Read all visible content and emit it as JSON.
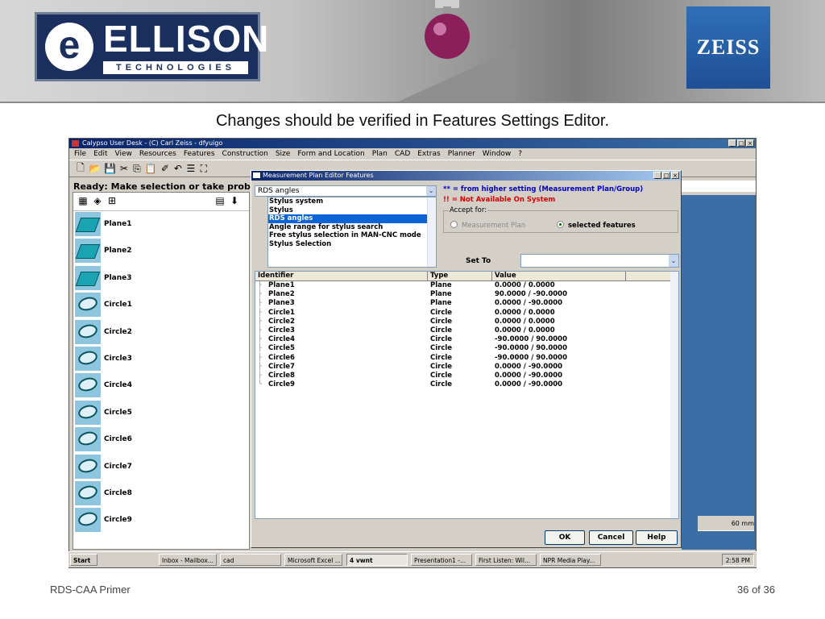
{
  "slide": {
    "caption": "Changes should be verified in Features Settings Editor.",
    "footer_left": "RDS-CAA Primer",
    "footer_right": "36 of 36",
    "logo_left": {
      "main": "ELLISON",
      "sub": "TECHNOLOGIES",
      "mark": "e"
    },
    "logo_right": "ZEISS"
  },
  "app": {
    "title": "Calypso User Desk - (C) Carl Zeiss - dfyuigo",
    "window_buttons": [
      "_",
      "□",
      "×"
    ],
    "menu": [
      "File",
      "Edit",
      "View",
      "Resources",
      "Features",
      "Construction",
      "Size",
      "Form and Location",
      "Plan",
      "CAD",
      "Extras",
      "Planner",
      "Window",
      "?"
    ],
    "status": "Ready: Make selection or take probings",
    "scale_label": "60 mm",
    "features": [
      {
        "name": "Plane1",
        "kind": "plane"
      },
      {
        "name": "Plane2",
        "kind": "plane"
      },
      {
        "name": "Plane3",
        "kind": "plane"
      },
      {
        "name": "Circle1",
        "kind": "circle"
      },
      {
        "name": "Circle2",
        "kind": "circle"
      },
      {
        "name": "Circle3",
        "kind": "circle"
      },
      {
        "name": "Circle4",
        "kind": "circle"
      },
      {
        "name": "Circle5",
        "kind": "circle"
      },
      {
        "name": "Circle6",
        "kind": "circle"
      },
      {
        "name": "Circle7",
        "kind": "circle"
      },
      {
        "name": "Circle8",
        "kind": "circle"
      },
      {
        "name": "Circle9",
        "kind": "circle"
      }
    ]
  },
  "dialog": {
    "title": "Measurement Plan Editor Features",
    "combo_value": "RDS angles",
    "list_items": [
      "Stylus system",
      "Stylus",
      "RDS angles",
      "Angle range for stylus search",
      "Free stylus selection in MAN-CNC mode",
      "Stylus Selection"
    ],
    "selected_index": 2,
    "legend_higher": "** = from higher setting (Measurement Plan/Group)",
    "legend_na": "!! = Not Available On System",
    "accept_title": "Accept for:",
    "accept_options": [
      "Measurement Plan",
      "selected features"
    ],
    "accept_selected": 1,
    "set_to_label": "Set To",
    "set_to_value": "",
    "columns": [
      "Identifier",
      "Type",
      "Value"
    ],
    "rows": [
      {
        "id": "Plane1",
        "type": "Plane",
        "value": "0.0000 / 0.0000"
      },
      {
        "id": "Plane2",
        "type": "Plane",
        "value": "90.0000 / -90.0000"
      },
      {
        "id": "Plane3",
        "type": "Plane",
        "value": "0.0000 / -90.0000"
      },
      {
        "id": "Circle1",
        "type": "Circle",
        "value": "0.0000 / 0.0000"
      },
      {
        "id": "Circle2",
        "type": "Circle",
        "value": "0.0000 / 0.0000"
      },
      {
        "id": "Circle3",
        "type": "Circle",
        "value": "0.0000 / 0.0000"
      },
      {
        "id": "Circle4",
        "type": "Circle",
        "value": "-90.0000 / 90.0000"
      },
      {
        "id": "Circle5",
        "type": "Circle",
        "value": "-90.0000 / 90.0000"
      },
      {
        "id": "Circle6",
        "type": "Circle",
        "value": "-90.0000 / 90.0000"
      },
      {
        "id": "Circle7",
        "type": "Circle",
        "value": "0.0000 / -90.0000"
      },
      {
        "id": "Circle8",
        "type": "Circle",
        "value": "0.0000 / -90.0000"
      },
      {
        "id": "Circle9",
        "type": "Circle",
        "value": "0.0000 / -90.0000"
      }
    ],
    "buttons": {
      "ok": "OK",
      "cancel": "Cancel",
      "help": "Help"
    }
  },
  "taskbar": {
    "start": "Start",
    "items": [
      "Inbox - Mailbox...",
      "cad",
      "Microsoft Excel ...",
      "4 vwnt",
      "Presentation1 -...",
      "First Listen: Wil...",
      "NPR Media Play..."
    ],
    "active_index": 3,
    "clock": "2:58 PM"
  },
  "colors": {
    "titlebar": "#0a246a",
    "selection": "#0a64d8",
    "feature_icon_bg": "#8dc6de",
    "zeiss_blue": "#2f6fb7",
    "ellison_navy": "#1b2f5e"
  }
}
